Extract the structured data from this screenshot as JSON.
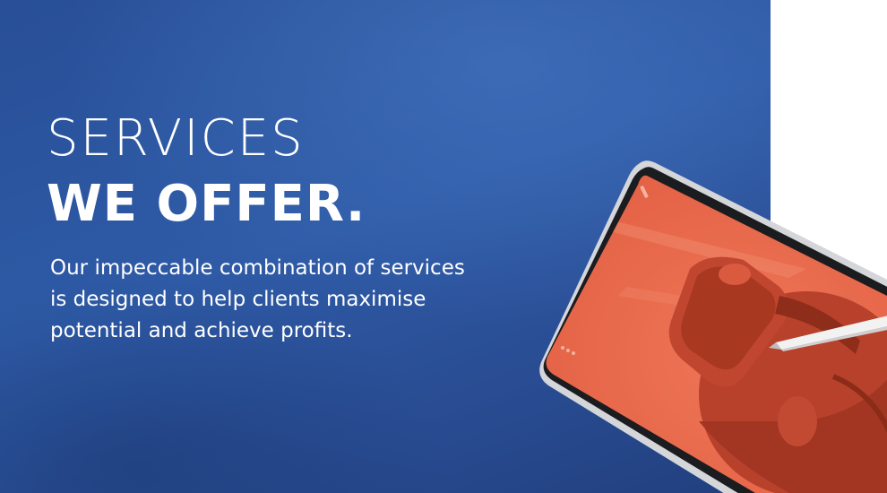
{
  "banner": {
    "title_line1": "SERVICES",
    "title_line2": "WE OFFER.",
    "description_lines": [
      "Our impeccable combination of services",
      "is designed to help clients maximise",
      "potential and achieve profits."
    ]
  },
  "colors": {
    "background_blue": "#2e5aa6",
    "screen_orange": "#e96a4d",
    "text": "#ffffff"
  },
  "icons": {
    "device": "tablet-with-stylus-illustration"
  }
}
